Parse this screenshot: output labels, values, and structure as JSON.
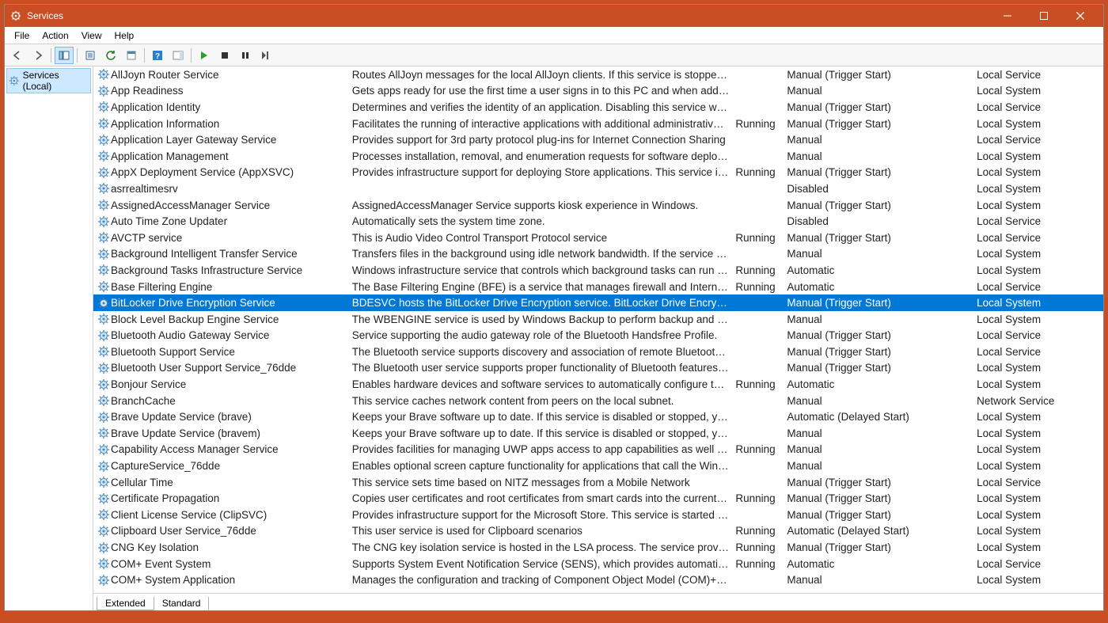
{
  "titlebar": {
    "title": "Services"
  },
  "menubar": [
    "File",
    "Action",
    "View",
    "Help"
  ],
  "tree": {
    "root": "Services (Local)"
  },
  "tabs": [
    "Extended",
    "Standard"
  ],
  "activeTab": 1,
  "selectedIndex": 14,
  "services": [
    {
      "name": "AllJoyn Router Service",
      "desc": "Routes AllJoyn messages for the local AllJoyn clients. If this service is stopped the ...",
      "status": "",
      "startup": "Manual (Trigger Start)",
      "logon": "Local Service"
    },
    {
      "name": "App Readiness",
      "desc": "Gets apps ready for use the first time a user signs in to this PC and when adding n...",
      "status": "",
      "startup": "Manual",
      "logon": "Local System"
    },
    {
      "name": "Application Identity",
      "desc": "Determines and verifies the identity of an application. Disabling this service will pr...",
      "status": "",
      "startup": "Manual (Trigger Start)",
      "logon": "Local Service"
    },
    {
      "name": "Application Information",
      "desc": "Facilitates the running of interactive applications with additional administrative pr...",
      "status": "Running",
      "startup": "Manual (Trigger Start)",
      "logon": "Local System"
    },
    {
      "name": "Application Layer Gateway Service",
      "desc": "Provides support for 3rd party protocol plug-ins for Internet Connection Sharing",
      "status": "",
      "startup": "Manual",
      "logon": "Local Service"
    },
    {
      "name": "Application Management",
      "desc": "Processes installation, removal, and enumeration requests for software deployed t...",
      "status": "",
      "startup": "Manual",
      "logon": "Local System"
    },
    {
      "name": "AppX Deployment Service (AppXSVC)",
      "desc": "Provides infrastructure support for deploying Store applications. This service is sta...",
      "status": "Running",
      "startup": "Manual (Trigger Start)",
      "logon": "Local System"
    },
    {
      "name": "asrrealtimesrv",
      "desc": "",
      "status": "",
      "startup": "Disabled",
      "logon": "Local System"
    },
    {
      "name": "AssignedAccessManager Service",
      "desc": "AssignedAccessManager Service supports kiosk experience in Windows.",
      "status": "",
      "startup": "Manual (Trigger Start)",
      "logon": "Local System"
    },
    {
      "name": "Auto Time Zone Updater",
      "desc": "Automatically sets the system time zone.",
      "status": "",
      "startup": "Disabled",
      "logon": "Local Service"
    },
    {
      "name": "AVCTP service",
      "desc": "This is Audio Video Control Transport Protocol service",
      "status": "Running",
      "startup": "Manual (Trigger Start)",
      "logon": "Local Service"
    },
    {
      "name": "Background Intelligent Transfer Service",
      "desc": "Transfers files in the background using idle network bandwidth. If the service is dis...",
      "status": "",
      "startup": "Manual",
      "logon": "Local System"
    },
    {
      "name": "Background Tasks Infrastructure Service",
      "desc": "Windows infrastructure service that controls which background tasks can run on t...",
      "status": "Running",
      "startup": "Automatic",
      "logon": "Local System"
    },
    {
      "name": "Base Filtering Engine",
      "desc": "The Base Filtering Engine (BFE) is a service that manages firewall and Internet Prot...",
      "status": "Running",
      "startup": "Automatic",
      "logon": "Local Service"
    },
    {
      "name": "BitLocker Drive Encryption Service",
      "desc": "BDESVC hosts the BitLocker Drive Encryption service. BitLocker Drive Encryption pr...",
      "status": "",
      "startup": "Manual (Trigger Start)",
      "logon": "Local System"
    },
    {
      "name": "Block Level Backup Engine Service",
      "desc": "The WBENGINE service is used by Windows Backup to perform backup and recove...",
      "status": "",
      "startup": "Manual",
      "logon": "Local System"
    },
    {
      "name": "Bluetooth Audio Gateway Service",
      "desc": "Service supporting the audio gateway role of the Bluetooth Handsfree Profile.",
      "status": "",
      "startup": "Manual (Trigger Start)",
      "logon": "Local Service"
    },
    {
      "name": "Bluetooth Support Service",
      "desc": "The Bluetooth service supports discovery and association of remote Bluetooth de...",
      "status": "",
      "startup": "Manual (Trigger Start)",
      "logon": "Local Service"
    },
    {
      "name": "Bluetooth User Support Service_76dde",
      "desc": "The Bluetooth user service supports proper functionality of Bluetooth features rel...",
      "status": "",
      "startup": "Manual (Trigger Start)",
      "logon": "Local System"
    },
    {
      "name": "Bonjour Service",
      "desc": "Enables hardware devices and software services to automatically configure themse...",
      "status": "Running",
      "startup": "Automatic",
      "logon": "Local System"
    },
    {
      "name": "BranchCache",
      "desc": "This service caches network content from peers on the local subnet.",
      "status": "",
      "startup": "Manual",
      "logon": "Network Service"
    },
    {
      "name": "Brave Update Service (brave)",
      "desc": "Keeps your Brave software up to date. If this service is disabled or stopped, your B...",
      "status": "",
      "startup": "Automatic (Delayed Start)",
      "logon": "Local System"
    },
    {
      "name": "Brave Update Service (bravem)",
      "desc": "Keeps your Brave software up to date. If this service is disabled or stopped, your B...",
      "status": "",
      "startup": "Manual",
      "logon": "Local System"
    },
    {
      "name": "Capability Access Manager Service",
      "desc": "Provides facilities for managing UWP apps access to app capabilities as well as che...",
      "status": "Running",
      "startup": "Manual",
      "logon": "Local System"
    },
    {
      "name": "CaptureService_76dde",
      "desc": "Enables optional screen capture functionality for applications that call the Windo...",
      "status": "",
      "startup": "Manual",
      "logon": "Local System"
    },
    {
      "name": "Cellular Time",
      "desc": "This service sets time based on NITZ messages from a Mobile Network",
      "status": "",
      "startup": "Manual (Trigger Start)",
      "logon": "Local Service"
    },
    {
      "name": "Certificate Propagation",
      "desc": "Copies user certificates and root certificates from smart cards into the current user'...",
      "status": "Running",
      "startup": "Manual (Trigger Start)",
      "logon": "Local System"
    },
    {
      "name": "Client License Service (ClipSVC)",
      "desc": "Provides infrastructure support for the Microsoft Store. This service is started on d...",
      "status": "",
      "startup": "Manual (Trigger Start)",
      "logon": "Local System"
    },
    {
      "name": "Clipboard User Service_76dde",
      "desc": "This user service is used for Clipboard scenarios",
      "status": "Running",
      "startup": "Automatic (Delayed Start)",
      "logon": "Local System"
    },
    {
      "name": "CNG Key Isolation",
      "desc": "The CNG key isolation service is hosted in the LSA process. The service provides ke...",
      "status": "Running",
      "startup": "Manual (Trigger Start)",
      "logon": "Local System"
    },
    {
      "name": "COM+ Event System",
      "desc": "Supports System Event Notification Service (SENS), which provides automatic distri...",
      "status": "Running",
      "startup": "Automatic",
      "logon": "Local Service"
    },
    {
      "name": "COM+ System Application",
      "desc": "Manages the configuration and tracking of Component Object Model (COM)+-ba...",
      "status": "",
      "startup": "Manual",
      "logon": "Local System"
    }
  ]
}
